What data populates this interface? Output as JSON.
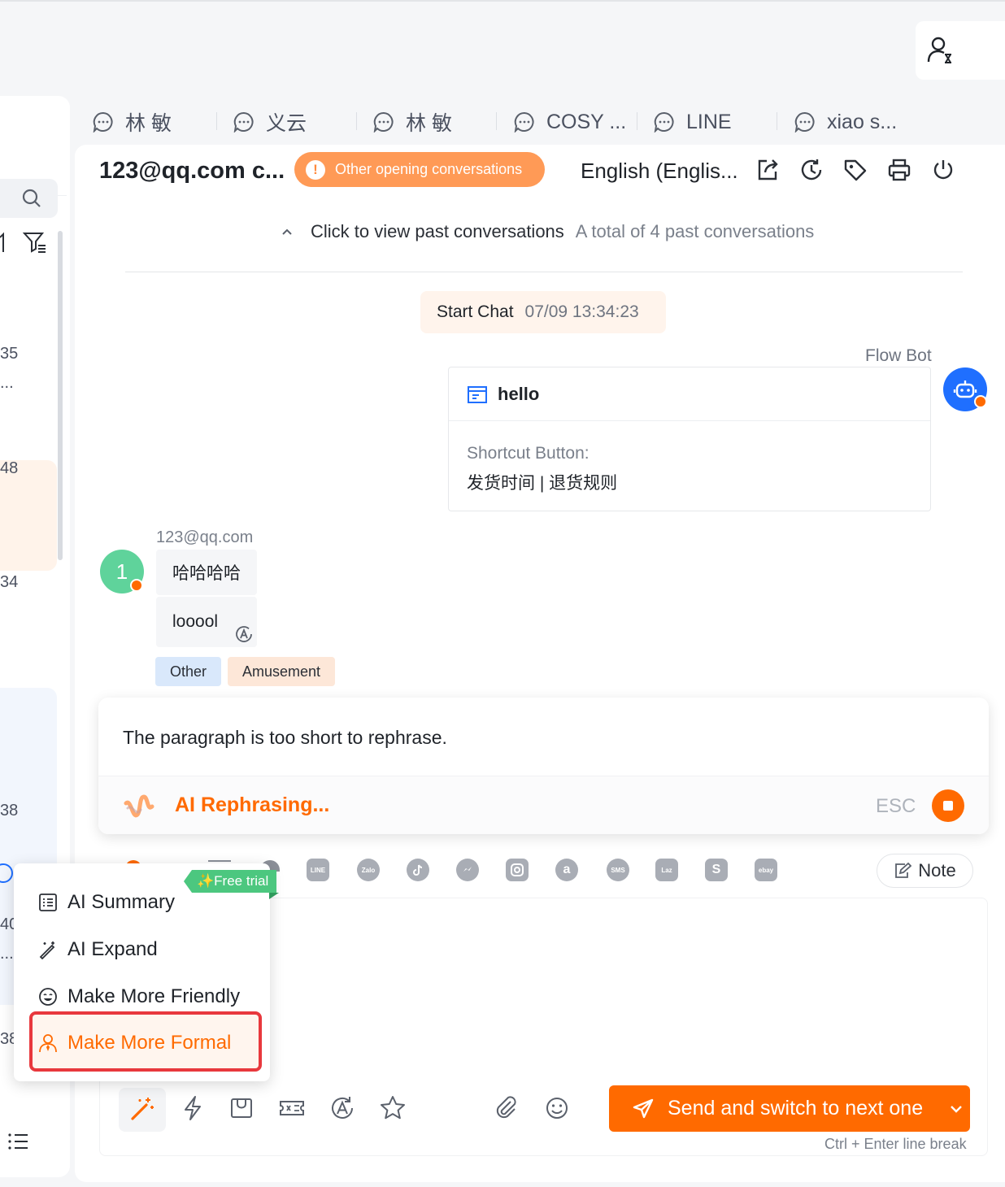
{
  "tabs": [
    {
      "label": "林 敏"
    },
    {
      "label": "义云"
    },
    {
      "label": "林 敏"
    },
    {
      "label": "COSY ..."
    },
    {
      "label": "LINE"
    },
    {
      "label": "xiao s..."
    }
  ],
  "left_list": {
    "numbers": [
      "35",
      "...",
      "48",
      "34",
      "38",
      "40",
      "...",
      "38"
    ]
  },
  "header": {
    "title": "123@qq.com c...",
    "warning": "Other opening conversations",
    "warning_icon": "!",
    "language": "English (Englis..."
  },
  "history": {
    "link": "Click to view past conversations",
    "count": "A total of 4 past conversations"
  },
  "start_chat": {
    "label": "Start Chat",
    "time": "07/09 13:34:23"
  },
  "bot": {
    "name": "Flow Bot",
    "title": "hello",
    "shortcut_label": "Shortcut Button:",
    "shortcut_value": "发货时间 | 退货规则"
  },
  "user": {
    "email": "123@qq.com",
    "avatar_text": "1",
    "messages": [
      "哈哈哈哈",
      "looool"
    ],
    "tags": [
      "Other",
      "Amusement"
    ]
  },
  "rephrase": {
    "message": "The paragraph is too short to rephrase.",
    "status": "AI Rephrasing...",
    "esc": "ESC"
  },
  "channels": [
    "LINE",
    "Zalo",
    "TikTok",
    "Messenger",
    "Instagram",
    "Amazon",
    "SMS",
    "Lazada",
    "Shopee",
    "eBay"
  ],
  "channel_labels": {
    "line": "LINE",
    "zalo": "Zalo",
    "sms": "SMS",
    "laz": "Laz",
    "ebay": "ebay",
    "shopee": "S",
    "amazon": "a"
  },
  "note_label": "Note",
  "ai_menu": {
    "badge": "✨Free trial",
    "items": [
      "AI Summary",
      "AI Expand",
      "Make More Friendly",
      "Make More Formal"
    ]
  },
  "send": {
    "label": "Send and switch to next one",
    "hint": "Ctrl + Enter line break"
  },
  "colors": {
    "accent": "#ff6a00",
    "bot_blue": "#1f6fff",
    "user_green": "#5fd39b",
    "tag_blue": "#d9e8fb",
    "tag_orange": "#fde7d8"
  }
}
